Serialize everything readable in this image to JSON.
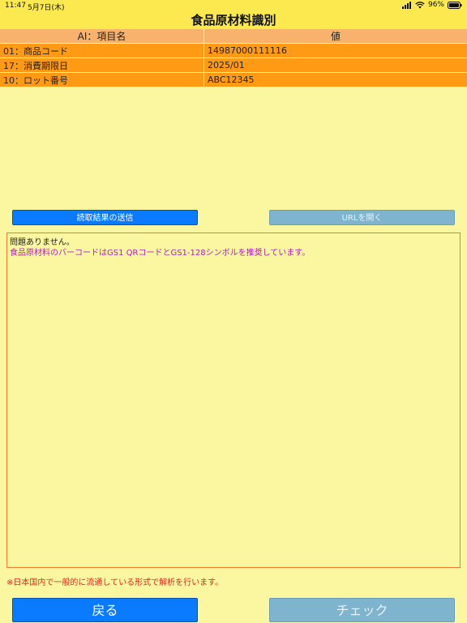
{
  "status_bar": {
    "time": "11:47",
    "date": "5月7日(木)",
    "battery": "96%",
    "icons": [
      "signal-icon",
      "wifi-icon",
      "battery-icon"
    ]
  },
  "title": "食品原材料識別",
  "table": {
    "headers": [
      "AI：項目名",
      "値"
    ],
    "rows": [
      [
        "01：商品コード",
        "14987000111116"
      ],
      [
        "17：消費期限日",
        "2025/01"
      ],
      [
        "10：ロット番号",
        "ABC12345"
      ]
    ]
  },
  "buttons": {
    "send": "読取結果の送信",
    "open_url": "URLを開く",
    "back": "戻る",
    "check": "チェック"
  },
  "result": {
    "line1": "問題ありません。",
    "line2": "食品原材料のバーコードはGS1 QRコードとGS1-128シンボルを推奨しています。"
  },
  "note": "※日本国内で一般的に流通している形式で解析を行います。",
  "colors": {
    "background": "#fbf7a1",
    "title_bar": "#fbe94f",
    "table_row": "#ff9a14",
    "primary_button": "#0a7bff",
    "disabled_button": "#7fb4cf",
    "note_text": "#e0241b",
    "info_text": "#b121b7"
  }
}
